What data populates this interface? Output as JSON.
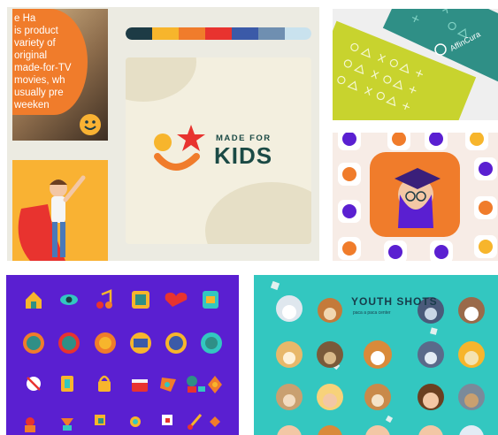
{
  "photo_text": {
    "lines": [
      "e Ha",
      "is product",
      "variety of",
      "original",
      "made-for-TV",
      "movies, wh",
      "usually pre",
      "weeken"
    ]
  },
  "logo": {
    "line1": "MADE FOR",
    "line2": "KIDS"
  },
  "palette": [
    "#1d3b45",
    "#f7b52c",
    "#f07c2b",
    "#e8332f",
    "#3b5aa8",
    "#6f8fb1",
    "#c9e2ee"
  ],
  "stationery": {
    "brand": "AffinCura"
  },
  "poster": {
    "title": "YOUTH SHOTS",
    "subtitle": "paca a paca center"
  },
  "colors": {
    "lime": "#c8d32e",
    "teal": "#2f8f86",
    "purple": "#5a1fd1",
    "poster_bg": "#33c7c0",
    "navy": "#1b4a45",
    "red": "#e8332f",
    "orange": "#f07c2b"
  }
}
